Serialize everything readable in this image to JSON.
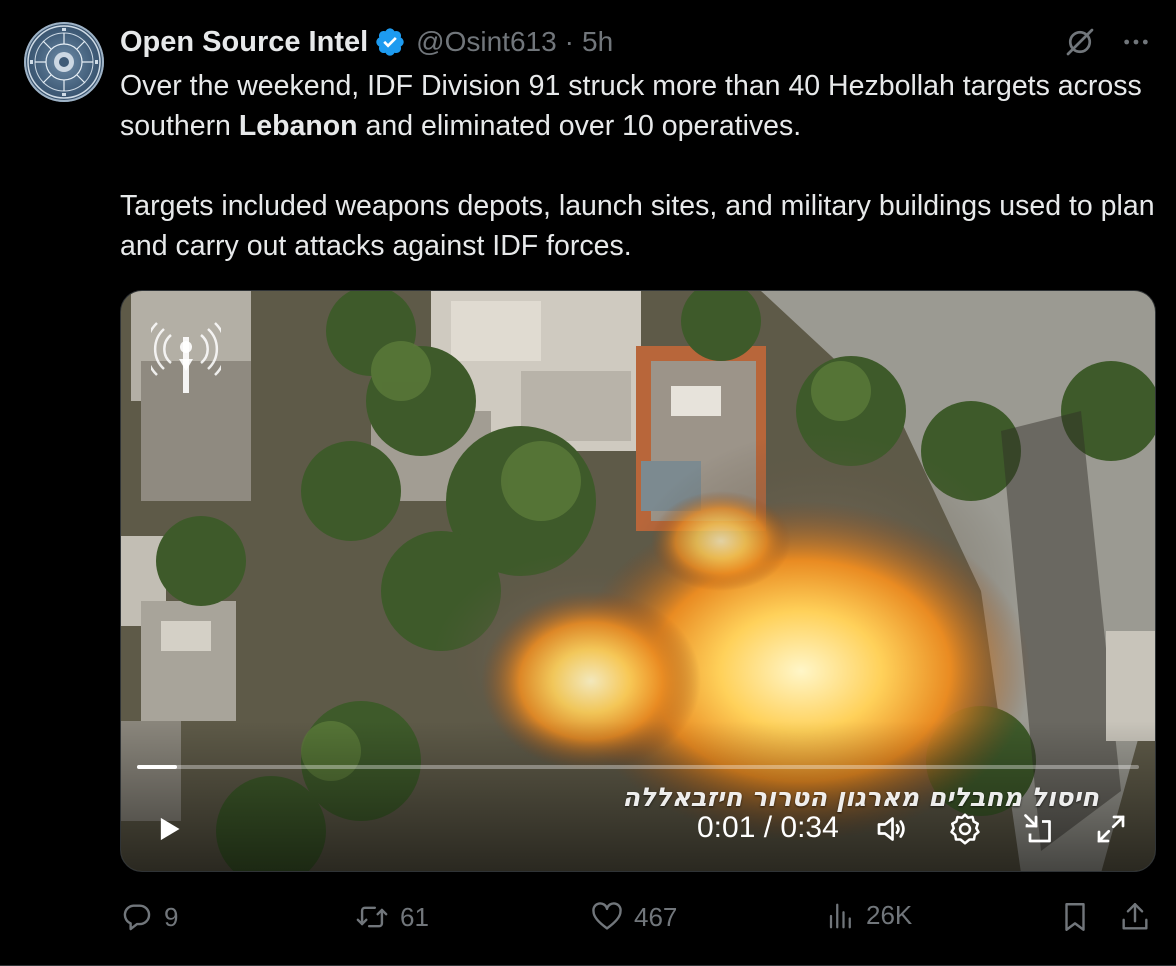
{
  "author": {
    "display_name": "Open Source Intel",
    "handle": "@Osint613",
    "separator": "·",
    "time": "5h",
    "verified_color": "#1d9bf0"
  },
  "tweet": {
    "paragraph1_before": "Over the weekend, IDF Division 91 struck more than 40 Hezbollah targets across southern ",
    "paragraph1_bold": "Lebanon",
    "paragraph1_after": " and eliminated over 10 operatives.",
    "paragraph2": "Targets included weapons depots, launch sites, and military buildings used to plan and carry out attacks against IDF forces."
  },
  "video": {
    "caption_hebrew": "חיסול מחבלים מארגון הטרור חיזבאללה",
    "timecode": "0:01 / 0:34",
    "progress_fraction": 0.04
  },
  "actions": {
    "replies": "9",
    "reposts": "61",
    "likes": "467",
    "views": "26K"
  },
  "icons": {
    "header": [
      "grok-icon",
      "more-icon"
    ],
    "video": [
      "play-icon",
      "volume-icon",
      "settings-icon",
      "pip-icon",
      "fullscreen-icon"
    ],
    "actions": [
      "reply-icon",
      "repost-icon",
      "like-icon",
      "views-icon",
      "bookmark-icon",
      "share-icon"
    ]
  },
  "colors": {
    "background": "#000000",
    "text": "#e7e9ea",
    "muted": "#71767b",
    "accent": "#1d9bf0"
  }
}
